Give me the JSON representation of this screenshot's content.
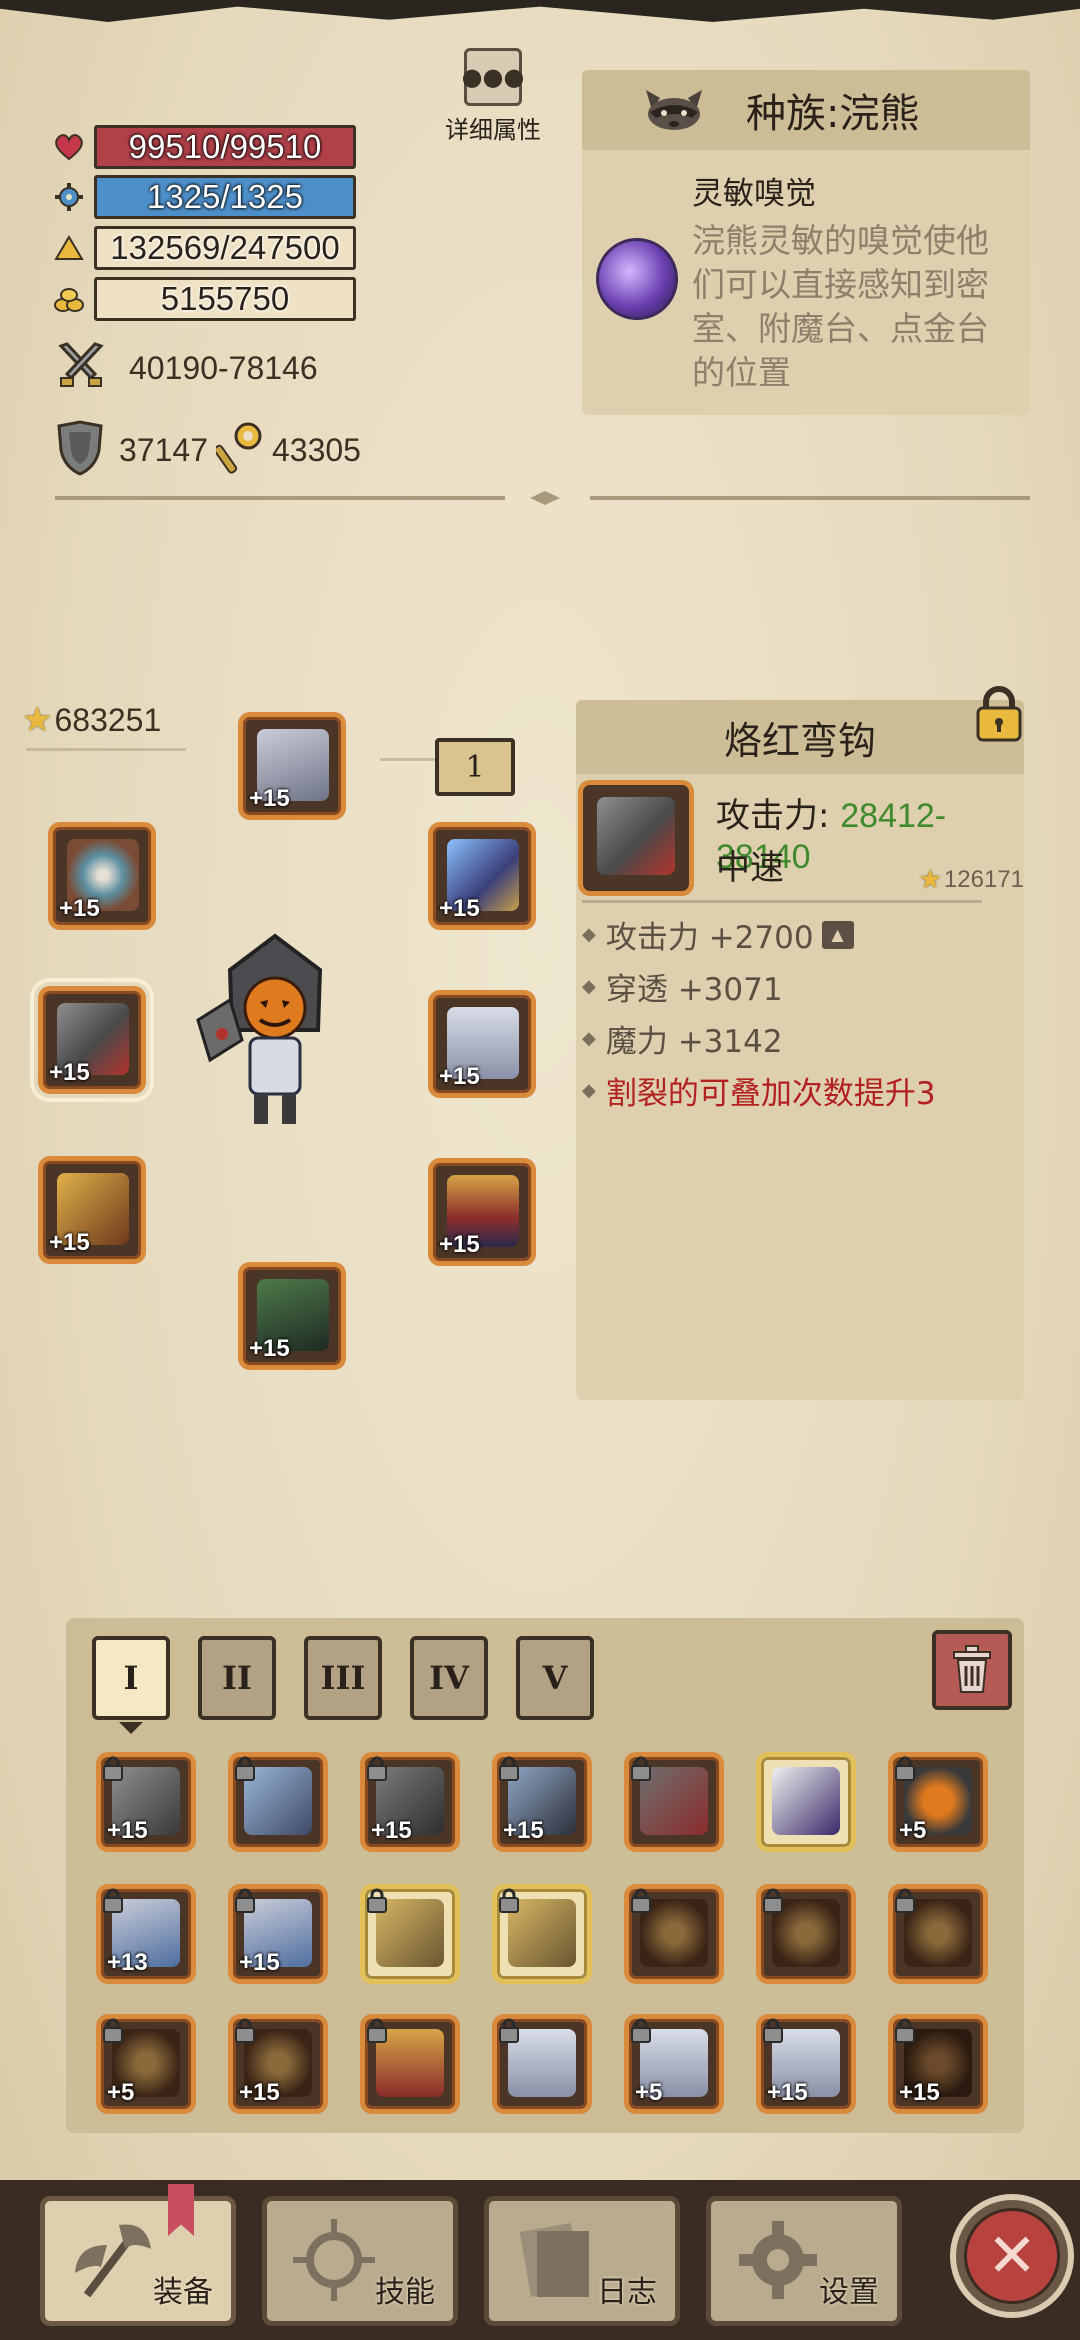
{
  "stats": {
    "hp": "99510/99510",
    "mana": "1325/1325",
    "exp": "132569/247500",
    "gold": "5155750",
    "attack": "40190-78146",
    "armor": "37147",
    "magic": "43305"
  },
  "detail_button": {
    "label": "详细属性"
  },
  "race": {
    "title": "种族:浣熊",
    "skill_name": "灵敏嗅觉",
    "skill_desc": "浣熊灵敏的嗅觉使他们可以直接感知到密室、附魔台、点金台的位置"
  },
  "equipment": {
    "total_score": "683251",
    "set_badge": "1",
    "slots": [
      {
        "name": "helmet",
        "plus": "+15"
      },
      {
        "name": "belt",
        "plus": "+15"
      },
      {
        "name": "staff",
        "plus": "+15"
      },
      {
        "name": "axe",
        "plus": "+15"
      },
      {
        "name": "wings",
        "plus": "+15"
      },
      {
        "name": "quiver",
        "plus": "+15"
      },
      {
        "name": "armor",
        "plus": "+15"
      },
      {
        "name": "cloak",
        "plus": "+15"
      }
    ]
  },
  "item": {
    "name": "烙红弯钩",
    "attack_label": "攻击力: ",
    "attack_value": "28412-38140",
    "speed": "中速",
    "score": "126171",
    "attrs": [
      {
        "text": "攻击力 +2700"
      },
      {
        "text": "穿透 +3071"
      },
      {
        "text": "魔力 +3142"
      },
      {
        "text": "割裂的可叠加次数提升3"
      }
    ]
  },
  "inventory": {
    "tabs": [
      "I",
      "II",
      "III",
      "IV",
      "V"
    ],
    "active_tab": "I",
    "items": [
      [
        "+15",
        "",
        "+15",
        "+15",
        "",
        "",
        "+5"
      ],
      [
        "+13",
        "+15",
        "",
        "",
        "",
        "",
        ""
      ],
      [
        "+5",
        "+15",
        "",
        "",
        "+5",
        "+15",
        "+15"
      ]
    ]
  },
  "nav": {
    "items": [
      "装备",
      "技能",
      "日志",
      "设置"
    ],
    "active": "装备"
  },
  "colors": {
    "hp": "#b14149",
    "mana": "#4d8fc9",
    "attack_value": "#3f8a2c",
    "special_attr": "#b32020",
    "slot_border": "#d98a3a"
  }
}
